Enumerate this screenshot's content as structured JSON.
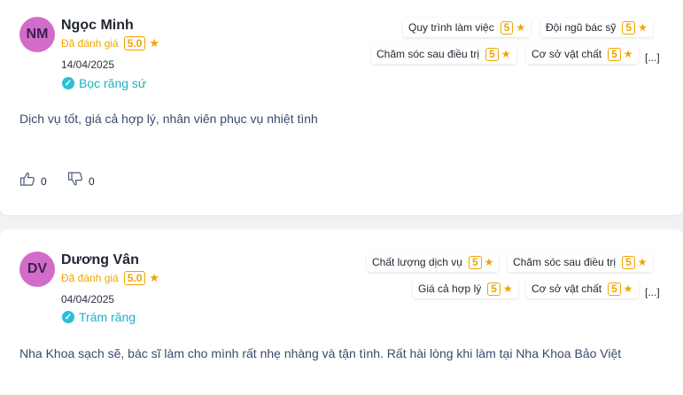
{
  "rating_label": "Đã đánh giá",
  "reviews": [
    {
      "initials": "NM",
      "name": "Ngọc Minh",
      "score": "5.0",
      "date": "14/04/2025",
      "service": "Bọc răng sứ",
      "criteria": [
        {
          "label": "Quy trình làm việc",
          "score": "5"
        },
        {
          "label": "Đội ngũ bác sỹ",
          "score": "5"
        },
        {
          "label": "Chăm sóc sau điều trị",
          "score": "5"
        },
        {
          "label": "Cơ sở vật chất",
          "score": "5"
        }
      ],
      "more": "[...]",
      "comment": "Dịch vụ tốt, giá cả hợp lý, nhân viên phục vụ nhiệt tình",
      "likes": "0",
      "dislikes": "0"
    },
    {
      "initials": "DV",
      "name": "Dương Vân",
      "score": "5.0",
      "date": "04/04/2025",
      "service": "Trám răng",
      "criteria": [
        {
          "label": "Chất lượng dịch vụ",
          "score": "5"
        },
        {
          "label": "Chăm sóc sau điều trị",
          "score": "5"
        },
        {
          "label": "Giá cả hợp lý",
          "score": "5"
        },
        {
          "label": "Cơ sở vật chất",
          "score": "5"
        }
      ],
      "more": "[...]",
      "comment": "Nha Khoa sạch sẽ, bác sĩ làm cho mình rất nhẹ nhàng và tận tình. Rất hài lòng khi làm tại Nha Khoa Bảo Việt"
    }
  ],
  "colors": {
    "accent": "#f0a400",
    "avatar": "#d16dc8",
    "service": "#20b0c6"
  },
  "icons": [
    "star-icon",
    "check-circle-icon",
    "thumbs-up-icon",
    "thumbs-down-icon"
  ]
}
